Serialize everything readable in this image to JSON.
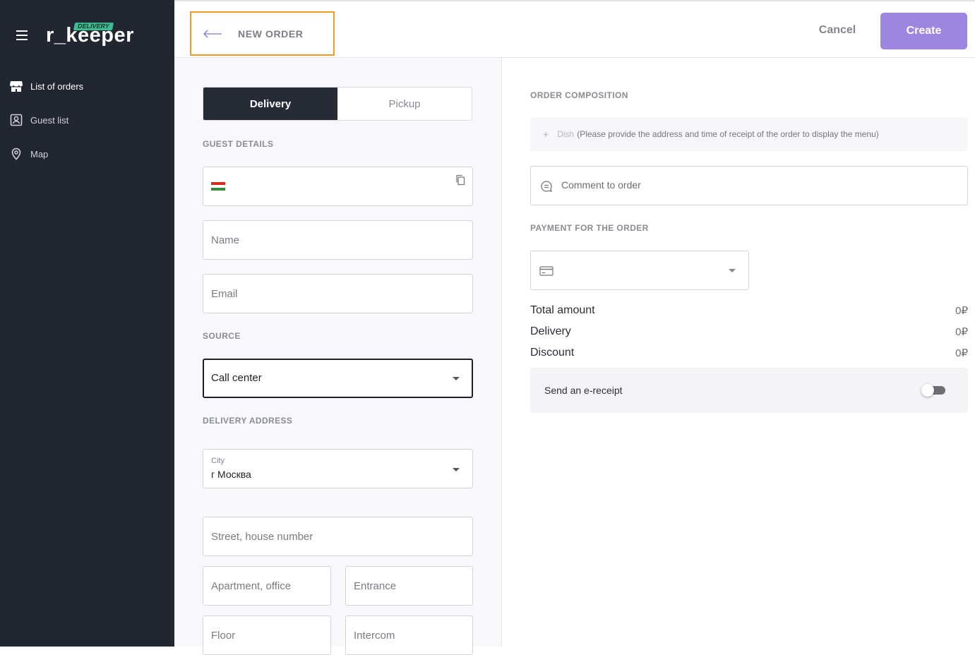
{
  "sidebar": {
    "logo_text": "r_keeper",
    "logo_tag": "DELIVERY",
    "items": [
      {
        "label": "List of orders",
        "icon": "store-icon"
      },
      {
        "label": "Guest list",
        "icon": "guest-card-icon"
      },
      {
        "label": "Map",
        "icon": "map-pin-icon"
      }
    ]
  },
  "topbar": {
    "title": "NEW ORDER",
    "cancel_label": "Cancel",
    "create_label": "Create"
  },
  "order_type": {
    "options": [
      "Delivery",
      "Pickup"
    ],
    "selected": "Delivery"
  },
  "guest": {
    "heading": "GUEST DETAILS",
    "phone_value": "",
    "name_placeholder": "Name",
    "email_placeholder": "Email"
  },
  "source": {
    "heading": "SOURCE",
    "value": "Call center"
  },
  "address": {
    "heading": "DELIVERY ADDRESS",
    "city_label": "City",
    "city_value": "г Москва",
    "street_placeholder": "Street, house number",
    "apartment_placeholder": "Apartment, office",
    "entrance_placeholder": "Entrance",
    "floor_placeholder": "Floor",
    "intercom_placeholder": "Intercom"
  },
  "composition": {
    "heading": "ORDER COMPOSITION",
    "dish_label": "Dish",
    "dish_hint": "(Please provide the address and time of receipt of the order to display the menu)",
    "comment_placeholder": "Comment to order"
  },
  "payment": {
    "heading": "PAYMENT FOR THE ORDER",
    "value": ""
  },
  "totals": [
    {
      "label": "Total amount",
      "value": "0₽"
    },
    {
      "label": "Delivery",
      "value": "0₽"
    },
    {
      "label": "Discount",
      "value": "0₽"
    }
  ],
  "receipt": {
    "label": "Send an e-receipt",
    "enabled": false
  },
  "colors": {
    "sidebar_bg": "#222630",
    "accent": "#9d86e0",
    "highlight_border": "#f59a23",
    "logo_tag": "#3ebc8f"
  }
}
